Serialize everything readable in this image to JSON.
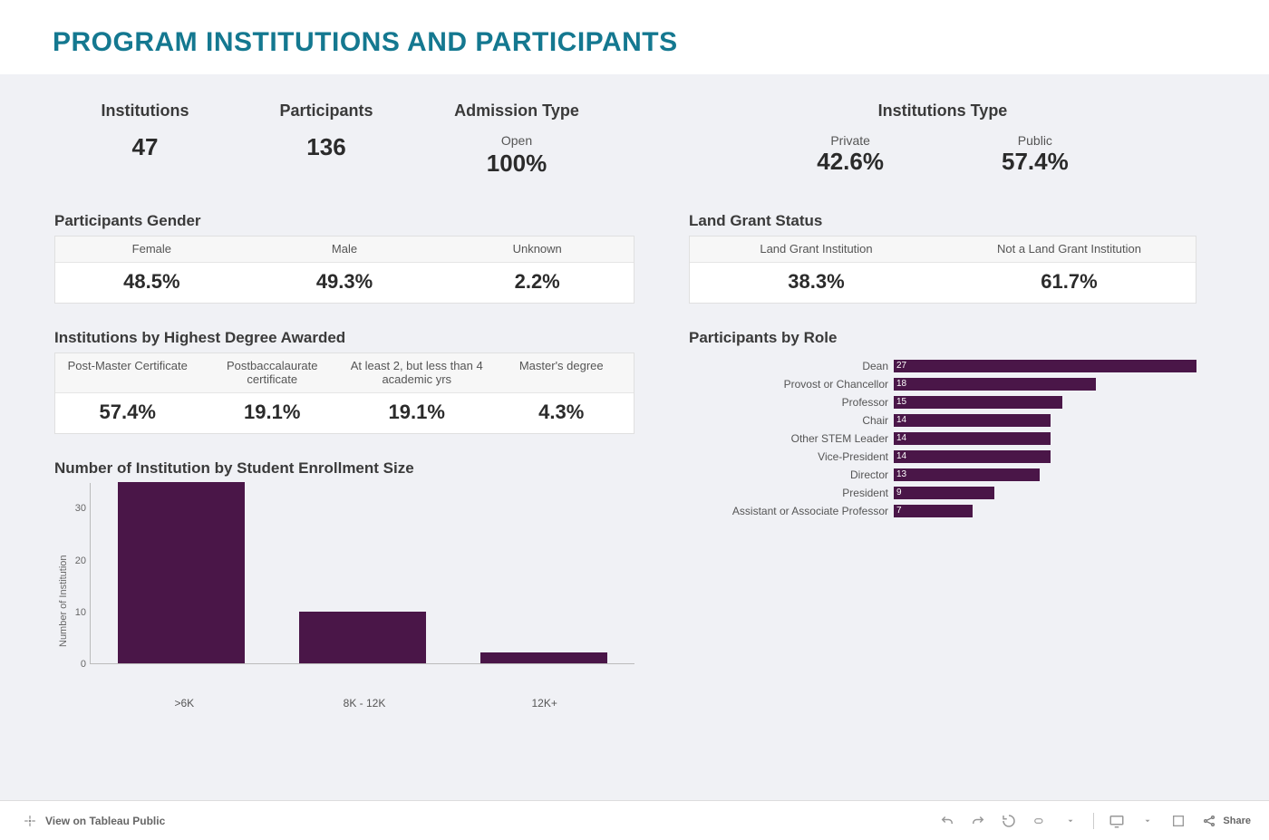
{
  "title": "PROGRAM INSTITUTIONS AND PARTICIPANTS",
  "kpis": {
    "institutions": {
      "label": "Institutions",
      "value": "47"
    },
    "participants": {
      "label": "Participants",
      "value": "136"
    },
    "admission": {
      "label": "Admission Type",
      "sublabel": "Open",
      "value": "100%"
    }
  },
  "institutions_type": {
    "title": "Institutions Type",
    "private": {
      "label": "Private",
      "value": "42.6%"
    },
    "public": {
      "label": "Public",
      "value": "57.4%"
    }
  },
  "participants_gender": {
    "title": "Participants Gender",
    "cols": [
      "Female",
      "Male",
      "Unknown"
    ],
    "vals": [
      "48.5%",
      "49.3%",
      "2.2%"
    ]
  },
  "land_grant": {
    "title": "Land Grant Status",
    "cols": [
      "Land Grant Institution",
      "Not a Land Grant Institution"
    ],
    "vals": [
      "38.3%",
      "61.7%"
    ]
  },
  "highest_degree": {
    "title": "Institutions by Highest Degree Awarded",
    "cols": [
      "Post-Master Certificate",
      "Postbaccalaurate certificate",
      "At least 2, but less than 4 academic yrs",
      "Master's degree"
    ],
    "vals": [
      "57.4%",
      "19.1%",
      "19.1%",
      "4.3%"
    ]
  },
  "enrollment_chart": {
    "title": "Number of Institution by Student Enrollment Size",
    "ylabel": "Number of Institution"
  },
  "roles_chart": {
    "title": "Participants by Role"
  },
  "footer": {
    "view_label": "View on Tableau Public",
    "share_label": "Share"
  },
  "chart_data": [
    {
      "type": "bar",
      "id": "enrollment",
      "title": "Number of Institution by Student Enrollment Size",
      "ylabel": "Number of Institution",
      "ylim": [
        0,
        35
      ],
      "yticks": [
        0,
        10,
        20,
        30
      ],
      "categories": [
        ">6K",
        "8K - 12K",
        "12K+"
      ],
      "values": [
        35,
        10,
        2
      ]
    },
    {
      "type": "bar",
      "orientation": "horizontal",
      "id": "roles",
      "title": "Participants by Role",
      "categories": [
        "Dean",
        "Provost or Chancellor",
        "Professor",
        "Chair",
        "Other STEM Leader",
        "Vice-President",
        "Director",
        "President",
        "Assistant or Associate Professor"
      ],
      "values": [
        27,
        18,
        15,
        14,
        14,
        14,
        13,
        9,
        7
      ],
      "xlim": [
        0,
        27
      ]
    }
  ]
}
